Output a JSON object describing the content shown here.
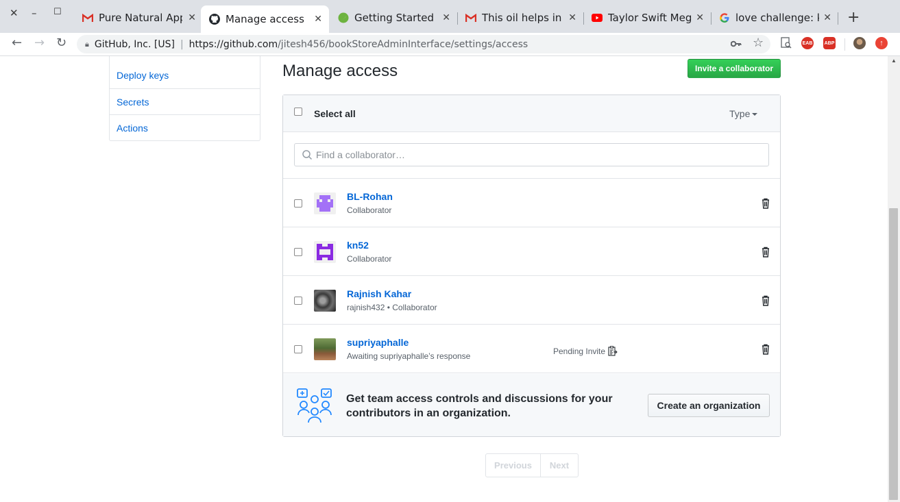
{
  "browser": {
    "tabs": [
      {
        "title": "Pure Natural Appl",
        "favicon": "gmail-icon"
      },
      {
        "title": "Manage access",
        "favicon": "github-icon"
      },
      {
        "title": "Getting Started | \\",
        "favicon": "spring-icon"
      },
      {
        "title": "This oil helps in fi",
        "favicon": "gmail-icon"
      },
      {
        "title": "Taylor Swift Mega",
        "favicon": "youtube-icon"
      },
      {
        "title": "love challenge: ki",
        "favicon": "google-icon"
      }
    ],
    "site_identity": "GitHub, Inc. [US]",
    "url_host": "https://github.com",
    "url_path": "/jitesh456/bookStoreAdminInterface/settings/access",
    "extensions": [
      {
        "label": "EAB",
        "color": "#d93025"
      },
      {
        "label": "ABP",
        "color": "#d93025"
      }
    ]
  },
  "sidebar": {
    "items": [
      {
        "label": "Deploy keys"
      },
      {
        "label": "Secrets"
      },
      {
        "label": "Actions"
      }
    ]
  },
  "main": {
    "title": "Manage access",
    "invite_label": "Invite a collaborator",
    "select_all_label": "Select all",
    "type_label": "Type",
    "search_placeholder": "Find a collaborator…",
    "collaborators": [
      {
        "name": "BL-Rohan",
        "role": "Collaborator",
        "pending": ""
      },
      {
        "name": "kn52",
        "role": "Collaborator",
        "pending": ""
      },
      {
        "name": "Rajnish Kahar",
        "role": "rajnish432 • Collaborator",
        "pending": ""
      },
      {
        "name": "supriyaphalle",
        "role": "Awaiting supriyaphalle’s response",
        "pending": "Pending Invite"
      }
    ],
    "org_promo_text": "Get team access controls and discussions for your contributors in an organization.",
    "org_button_label": "Create an organization",
    "pagination": {
      "previous": "Previous",
      "next": "Next"
    }
  },
  "colors": {
    "link": "#0366d6",
    "primary_button": "#28a745",
    "avatar_bl_rohan": "#a371f7",
    "avatar_kn52": "#8a2be2"
  }
}
